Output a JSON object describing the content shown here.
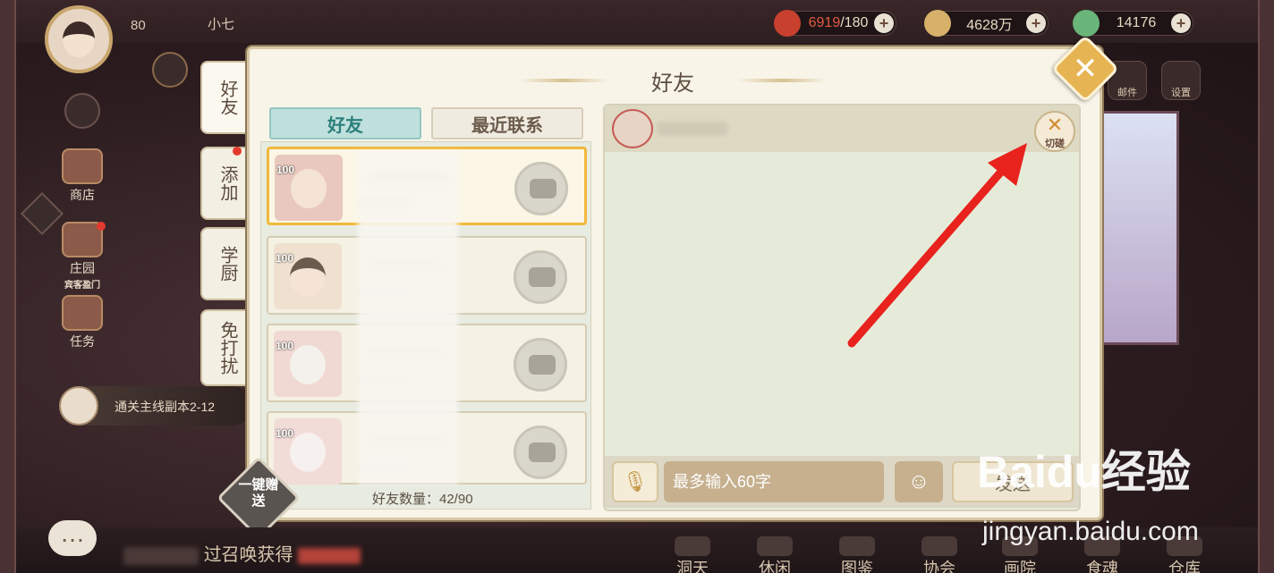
{
  "player": {
    "level": "80",
    "name": "小七"
  },
  "resources": [
    {
      "value": "6919",
      "cap": "/180",
      "color": "#c8402e"
    },
    {
      "value": "4628万",
      "color": "#d7b06a"
    },
    {
      "value": "14176",
      "color": "#6ab57a"
    }
  ],
  "left_menu": {
    "shop": "商店",
    "manor": "庄园",
    "manor_sub": "宾客盈门",
    "task": "任务"
  },
  "right_menu": {
    "mail": "邮件",
    "settings": "设置"
  },
  "side_tabs": [
    "好友",
    "添加",
    "学厨",
    "免打扰"
  ],
  "dialog": {
    "title": "好友",
    "tabs": {
      "friends": "好友",
      "recent": "最近联系"
    },
    "friends": [
      {
        "level": "100"
      },
      {
        "level": "100"
      },
      {
        "level": "100"
      },
      {
        "level": "100"
      }
    ],
    "friend_count_label": "好友数量：42/90",
    "one_key_gift": "一键赠送",
    "chat": {
      "spar_label": "切磋",
      "input_placeholder": "最多输入60字",
      "send_label": "发送"
    }
  },
  "quest": {
    "text": "通关主线副本2-12"
  },
  "notice": {
    "prefix": "过召唤获得"
  },
  "bottom_nav": [
    "洞天",
    "休闲",
    "图鉴",
    "协会",
    "画院",
    "食魂",
    "仓库"
  ],
  "watermark": {
    "brand": "Baidu经验",
    "url": "jingyan.baidu.com"
  },
  "annotation": {
    "arrow_color": "#e8221d"
  },
  "colors": {
    "accent_teal": "#2d7f7c",
    "selected_border": "#f0b93a",
    "close_button": "#e7b453"
  }
}
